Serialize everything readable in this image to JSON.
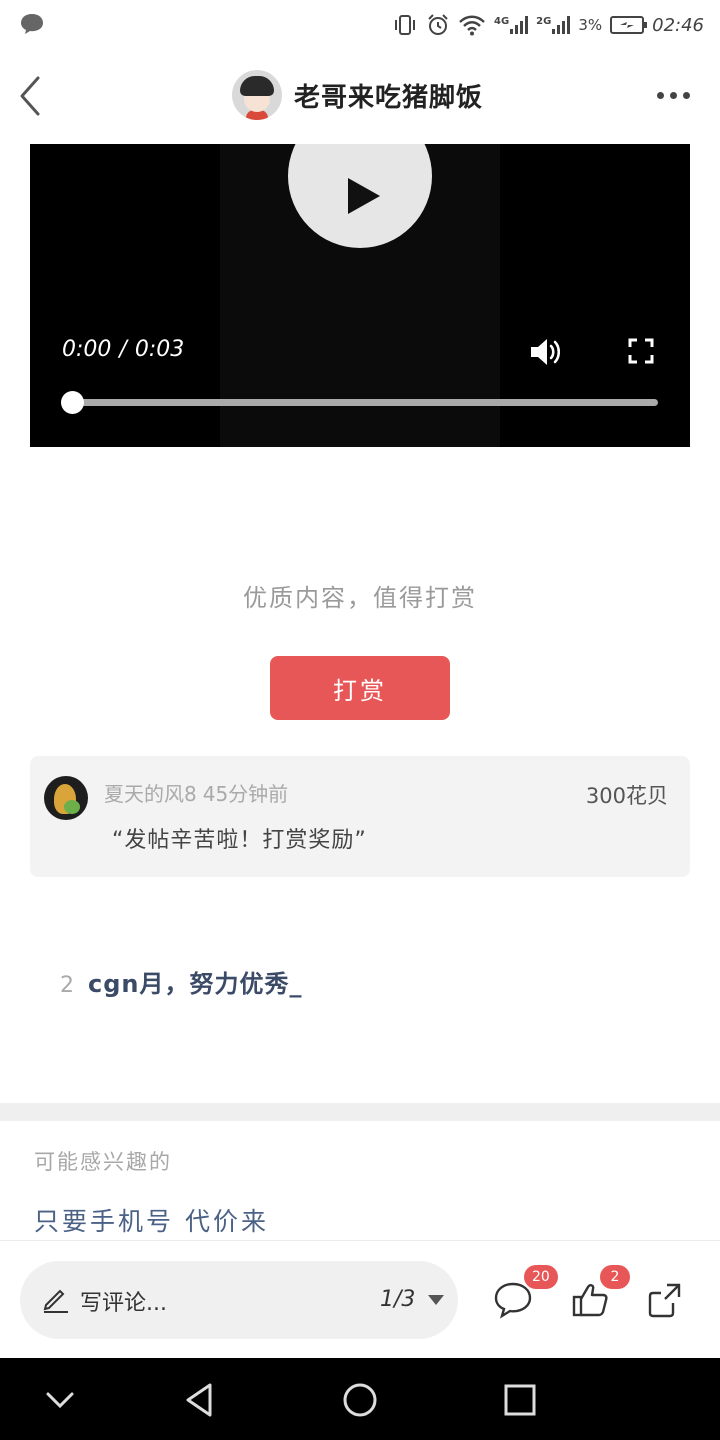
{
  "status_bar": {
    "network_4g": "4G",
    "network_2g": "2G",
    "battery_pct": "3%",
    "time": "02:46"
  },
  "header": {
    "title": "老哥来吃猪脚饭"
  },
  "video": {
    "current_time": "0:00",
    "separator": "/",
    "duration": "0:03",
    "progress": 0
  },
  "tip": {
    "prompt": "优质内容，值得打赏",
    "button_label": "打赏"
  },
  "reward": {
    "user": "夏天的风8",
    "time_ago": "45分钟前",
    "amount": "300花贝",
    "message": "“发帖辛苦啦！打赏奖励”"
  },
  "post": {
    "floor": "2",
    "text": "cgn月，努力优秀_"
  },
  "related": {
    "label": "可能感兴趣的",
    "item": "只要手机号 代价来"
  },
  "bottom_bar": {
    "comment_placeholder": "写评论...",
    "page_indicator": "1/3",
    "comment_count": "20",
    "like_count": "2"
  },
  "colors": {
    "accent": "#e85757",
    "link_text": "#4b6286"
  }
}
